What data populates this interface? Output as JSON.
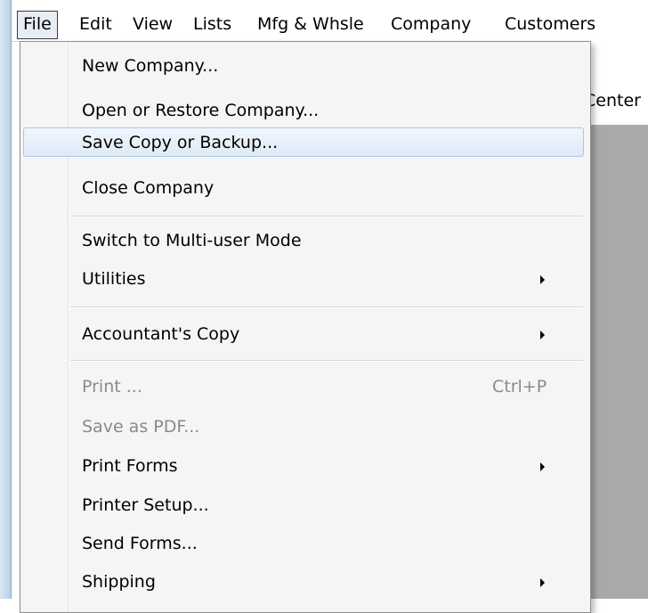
{
  "menubar": {
    "items": [
      {
        "label": "File"
      },
      {
        "label": "Edit"
      },
      {
        "label": "View"
      },
      {
        "label": "Lists"
      },
      {
        "label": "Mfg & Whsle"
      },
      {
        "label": "Company"
      },
      {
        "label": "Customers"
      }
    ]
  },
  "background": {
    "toolbar_label": "Center"
  },
  "file_menu": {
    "items": [
      {
        "label": "New Company..."
      },
      {
        "label": "Open or Restore Company..."
      },
      {
        "label": "Save Copy or Backup...",
        "highlighted": true
      },
      {
        "label": "Close Company"
      },
      {
        "label": "Switch to Multi-user Mode"
      },
      {
        "label": "Utilities",
        "submenu": true
      },
      {
        "label": "Accountant's Copy",
        "submenu": true
      },
      {
        "label": "Print ...",
        "shortcut": "Ctrl+P",
        "disabled": true
      },
      {
        "label": "Save as PDF...",
        "disabled": true
      },
      {
        "label": "Print Forms",
        "submenu": true
      },
      {
        "label": "Printer Setup..."
      },
      {
        "label": "Send Forms..."
      },
      {
        "label": "Shipping",
        "submenu": true
      }
    ]
  }
}
